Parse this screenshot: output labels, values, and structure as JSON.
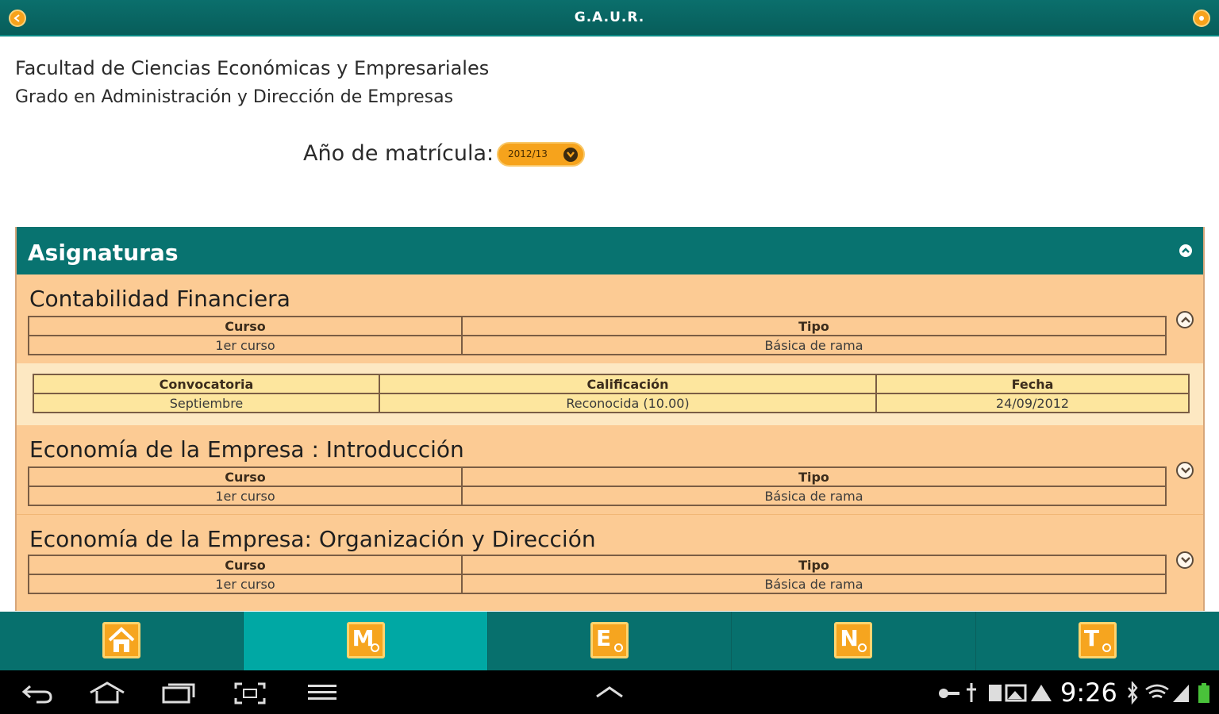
{
  "app": {
    "title": "G.A.U.R."
  },
  "header": {
    "faculty": "Facultad de Ciencias Económicas y Empresariales",
    "degree": "Grado en Administración y Dirección de Empresas",
    "year_label": "Año de matrícula:",
    "year_value": "2012/13"
  },
  "section": {
    "title": "Asignaturas"
  },
  "subjects": [
    {
      "name": "Contabilidad Financiera",
      "headers": [
        "Curso",
        "Tipo"
      ],
      "values": [
        "1er curso",
        "Básica de rama"
      ],
      "expanded": true,
      "detail": {
        "headers": [
          "Convocatoria",
          "Calificación",
          "Fecha"
        ],
        "values": [
          "Septiembre",
          "Reconocida (10.00)",
          "24/09/2012"
        ]
      }
    },
    {
      "name": "Economía de la Empresa : Introducción",
      "headers": [
        "Curso",
        "Tipo"
      ],
      "values": [
        "1er curso",
        "Básica de rama"
      ],
      "expanded": false
    },
    {
      "name": "Economía de la Empresa: Organización y Dirección",
      "headers": [
        "Curso",
        "Tipo"
      ],
      "values": [
        "1er curso",
        "Básica de rama"
      ],
      "expanded": false
    }
  ],
  "tabs": [
    {
      "glyph": "",
      "icon": "home-icon",
      "active": false
    },
    {
      "glyph": "M",
      "icon": "m-search-icon",
      "active": true
    },
    {
      "glyph": "E",
      "icon": "e-search-icon",
      "active": false
    },
    {
      "glyph": "N",
      "icon": "n-search-icon",
      "active": false
    },
    {
      "glyph": "T",
      "icon": "t-search-icon",
      "active": false
    }
  ],
  "system": {
    "clock": "9:26"
  },
  "colors": {
    "primary": "#087370",
    "accent": "#f6a31c",
    "row": "#fccb94",
    "detail": "#fde8c2",
    "tab_active": "#00a8a4"
  }
}
